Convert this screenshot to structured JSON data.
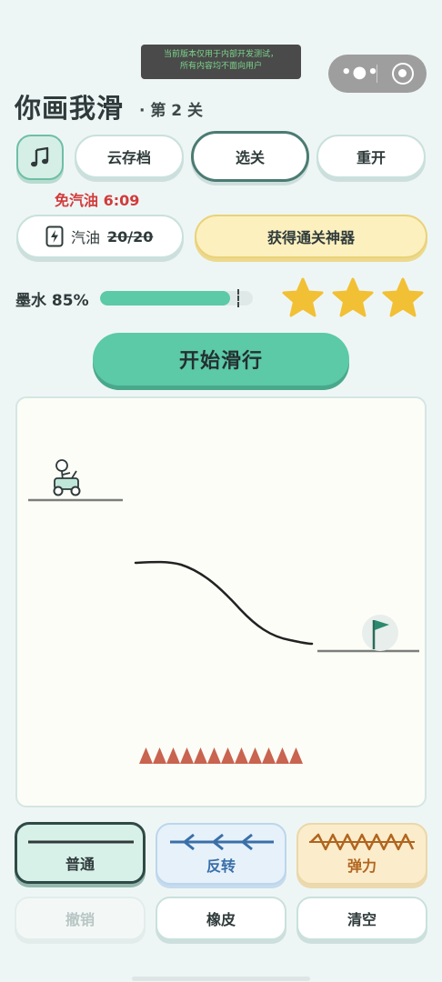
{
  "dev_notice": {
    "line1": "当前版本仅用于内部开发测试，",
    "line2": "所有内容均不面向用户"
  },
  "header": {
    "title": "你画我滑",
    "level": "· 第 2 关"
  },
  "toolbar": {
    "music_icon": "music-note-icon",
    "cloud_save": "云存档",
    "select_level": "选关",
    "restart": "重开"
  },
  "fuel": {
    "free_timer": "免汽油 6:09",
    "label": "汽油",
    "count": "20/20",
    "artifact_button": "获得通关神器"
  },
  "ink": {
    "label": "墨水 85%",
    "percent": 85,
    "stars": 3
  },
  "start_button": "开始滑行",
  "tools": {
    "normal": "普通",
    "reverse": "反转",
    "bounce": "弹力",
    "selected": "normal"
  },
  "actions": {
    "undo": "撤销",
    "eraser": "橡皮",
    "clear": "清空"
  },
  "colors": {
    "accent": "#5cc9a7",
    "star": "#f2c034",
    "spikes": "#c8644f",
    "danger_text": "#d23b3b"
  }
}
